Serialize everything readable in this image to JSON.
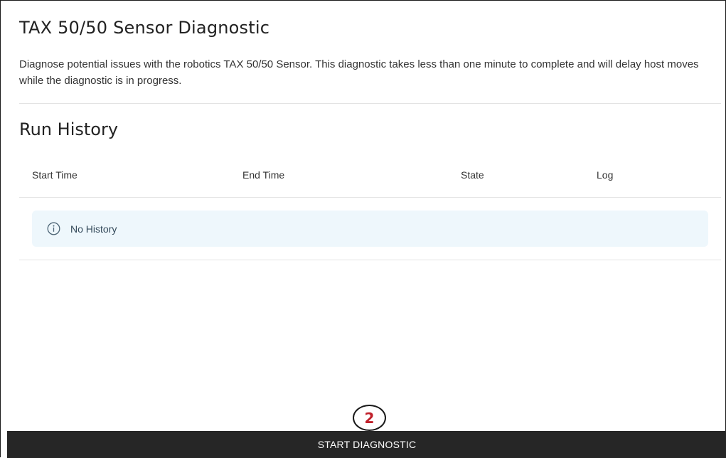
{
  "page": {
    "title": "TAX 50/50 Sensor Diagnostic",
    "description": "Diagnose potential issues with the robotics TAX 50/50 Sensor. This diagnostic takes less than one minute to complete and will delay host moves while the diagnostic is in progress."
  },
  "run_history": {
    "title": "Run History",
    "columns": [
      "Start Time",
      "End Time",
      "State",
      "Log"
    ],
    "empty_message": "No History",
    "empty_icon": "info-icon"
  },
  "annotation": {
    "step_number": "2",
    "color": "#c0202a"
  },
  "actions": {
    "start_label": "START DIAGNOSTIC"
  },
  "colors": {
    "button_bg": "#262626",
    "alert_bg": "#eef7fc"
  }
}
